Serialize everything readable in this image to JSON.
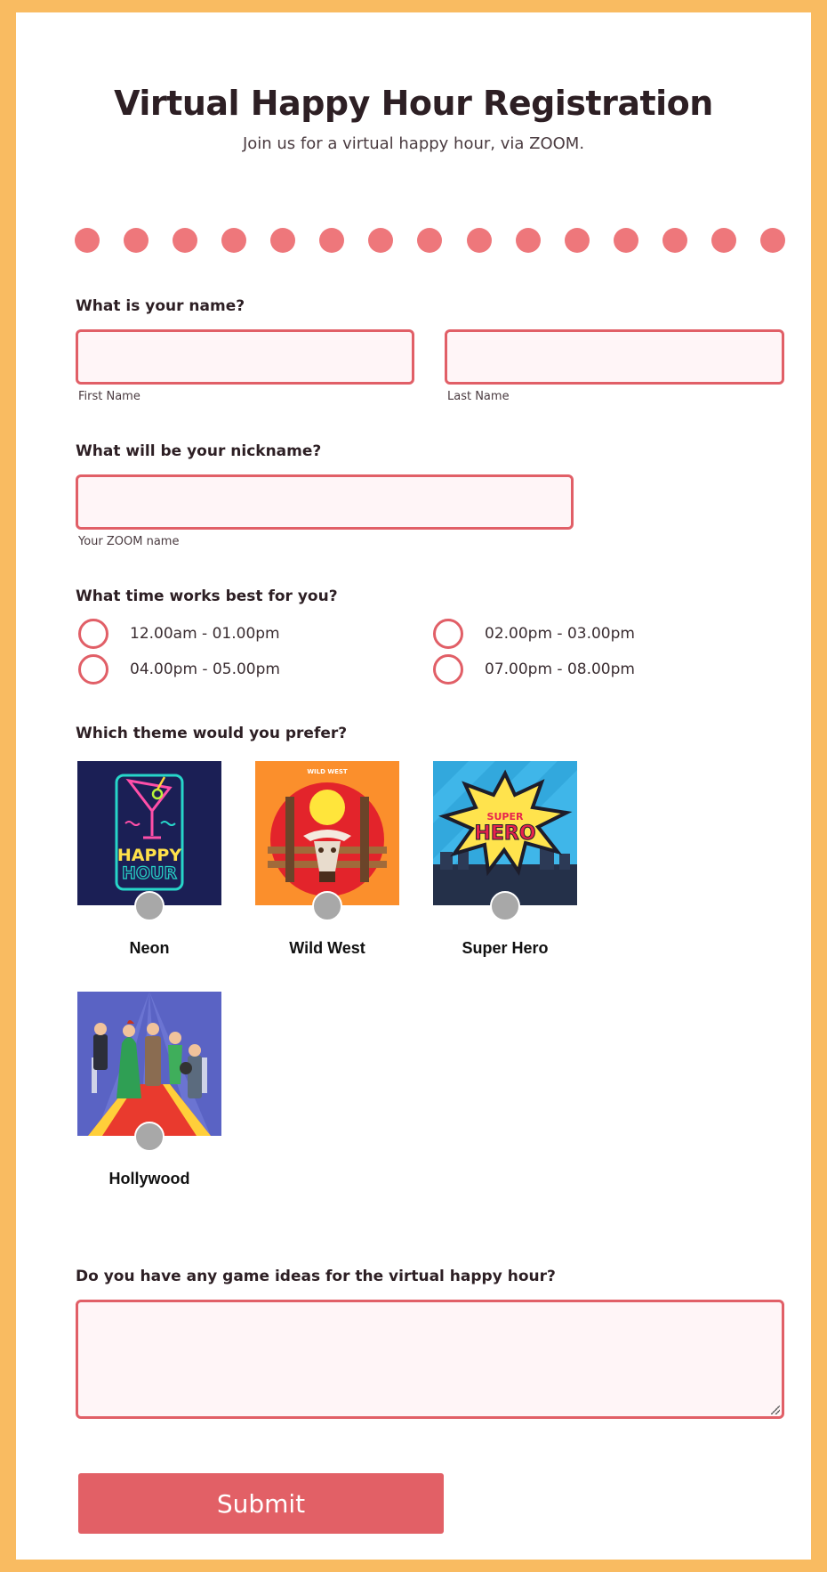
{
  "form": {
    "title": "Virtual Happy Hour Registration",
    "subtitle": "Join us for a virtual happy hour, via ZOOM.",
    "accent_color": "#e15f67",
    "border_color": "#f9bb61"
  },
  "name_question": {
    "label": "What is your name?",
    "first_name": {
      "value": "",
      "sublabel": "First Name"
    },
    "last_name": {
      "value": "",
      "sublabel": "Last Name"
    }
  },
  "nickname_question": {
    "label": "What will be your nickname?",
    "value": "",
    "sublabel": "Your ZOOM name"
  },
  "time_question": {
    "label": "What time works best for you?",
    "options": [
      {
        "label": "12.00am - 01.00pm",
        "selected": false
      },
      {
        "label": "02.00pm - 03.00pm",
        "selected": false
      },
      {
        "label": "04.00pm - 05.00pm",
        "selected": false
      },
      {
        "label": "07.00pm - 08.00pm",
        "selected": false
      }
    ]
  },
  "theme_question": {
    "label": "Which theme would you prefer?",
    "options": [
      {
        "name": "Neon",
        "image": "neon-happy-hour-image",
        "image_text": [
          "HAPPY",
          "HOUR"
        ],
        "selected": false
      },
      {
        "name": "Wild West",
        "image": "wild-west-image",
        "image_text": [
          "WILD WEST"
        ],
        "selected": false
      },
      {
        "name": "Super Hero",
        "image": "super-hero-image",
        "image_text": [
          "SUPER",
          "HERO"
        ],
        "selected": false
      },
      {
        "name": "Hollywood",
        "image": "hollywood-red-carpet-image",
        "image_text": [],
        "selected": false
      }
    ]
  },
  "games_question": {
    "label": "Do you have any game ideas for the virtual happy hour?",
    "value": ""
  },
  "submit": {
    "label": "Submit"
  }
}
